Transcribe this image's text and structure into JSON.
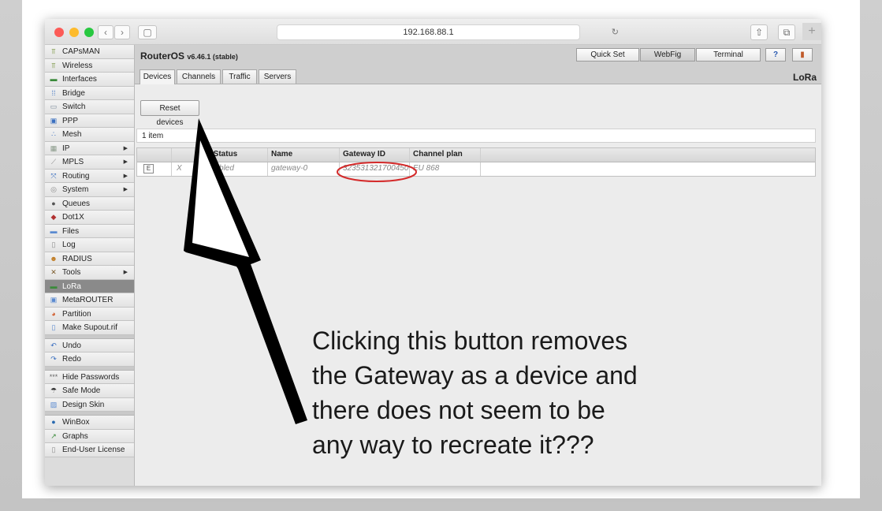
{
  "browser": {
    "address": "192.168.88.1"
  },
  "sidebar": {
    "items": [
      {
        "label": "CAPsMAN",
        "icon": "antenna-icon",
        "glyph": "⫪",
        "color": "#6a8a2a"
      },
      {
        "label": "Wireless",
        "icon": "antenna-icon",
        "glyph": "⫪",
        "color": "#6a8a2a"
      },
      {
        "label": "Interfaces",
        "icon": "interfaces-icon",
        "glyph": "▬",
        "color": "#3a8a3a"
      },
      {
        "label": "Bridge",
        "icon": "bridge-icon",
        "glyph": "⁞⁞",
        "color": "#3a6fc0"
      },
      {
        "label": "Switch",
        "icon": "switch-icon",
        "glyph": "▭",
        "color": "#7a8a9a"
      },
      {
        "label": "PPP",
        "icon": "ppp-icon",
        "glyph": "▣",
        "color": "#3a6fc0"
      },
      {
        "label": "Mesh",
        "icon": "mesh-icon",
        "glyph": "∴",
        "color": "#3a6fc0"
      },
      {
        "label": "IP",
        "icon": "ip-icon",
        "glyph": "▦",
        "color": "#8a9a8a",
        "submenu": true
      },
      {
        "label": "MPLS",
        "icon": "mpls-icon",
        "glyph": "⟋",
        "color": "#8a8a8a",
        "submenu": true
      },
      {
        "label": "Routing",
        "icon": "routing-icon",
        "glyph": "⤧",
        "color": "#3a6fc0",
        "submenu": true
      },
      {
        "label": "System",
        "icon": "system-icon",
        "glyph": "◎",
        "color": "#8a8a8a",
        "submenu": true
      },
      {
        "label": "Queues",
        "icon": "queues-icon",
        "glyph": "●",
        "color": "#555555"
      },
      {
        "label": "Dot1X",
        "icon": "dot1x-icon",
        "glyph": "◆",
        "color": "#b03030"
      },
      {
        "label": "Files",
        "icon": "files-icon",
        "glyph": "▬",
        "color": "#5a8ad0"
      },
      {
        "label": "Log",
        "icon": "log-icon",
        "glyph": "▯",
        "color": "#8a8a8a"
      },
      {
        "label": "RADIUS",
        "icon": "radius-icon",
        "glyph": "☻",
        "color": "#c07a20"
      },
      {
        "label": "Tools",
        "icon": "tools-icon",
        "glyph": "✕",
        "color": "#7a5a2a",
        "submenu": true
      },
      {
        "label": "LoRa",
        "icon": "lora-icon",
        "glyph": "▬",
        "color": "#3a8a3a",
        "active": true
      },
      {
        "label": "MetaROUTER",
        "icon": "metarouter-icon",
        "glyph": "▣",
        "color": "#5a8ad0"
      },
      {
        "label": "Partition",
        "icon": "partition-icon",
        "glyph": "◕",
        "color": "#d05a2a"
      },
      {
        "label": "Make Supout.rif",
        "icon": "supout-icon",
        "glyph": "▯",
        "color": "#5a8ad0"
      },
      {
        "gap": true
      },
      {
        "label": "Undo",
        "icon": "undo-icon",
        "glyph": "↶",
        "color": "#3a6fc0"
      },
      {
        "label": "Redo",
        "icon": "redo-icon",
        "glyph": "↷",
        "color": "#3a6fc0"
      },
      {
        "gap": true
      },
      {
        "label": "Hide Passwords",
        "icon": "hide-passwords-icon",
        "glyph": "***",
        "color": "#666666"
      },
      {
        "label": "Safe Mode",
        "icon": "safe-mode-icon",
        "glyph": "☂",
        "color": "#333333"
      },
      {
        "label": "Design Skin",
        "icon": "design-skin-icon",
        "glyph": "▨",
        "color": "#5a8ad0"
      },
      {
        "gap": true
      },
      {
        "label": "WinBox",
        "icon": "winbox-icon",
        "glyph": "●",
        "color": "#2a6ab0"
      },
      {
        "label": "Graphs",
        "icon": "graphs-icon",
        "glyph": "↗",
        "color": "#3a8a3a"
      },
      {
        "label": "End-User License",
        "icon": "license-icon",
        "glyph": "▯",
        "color": "#8a8a8a"
      }
    ]
  },
  "header": {
    "product": "RouterOS",
    "version": "v6.46.1 (stable)",
    "quick_set": "Quick Set",
    "webfig": "WebFig",
    "terminal": "Terminal"
  },
  "tabs": [
    {
      "label": "Devices",
      "selected": true
    },
    {
      "label": "Channels"
    },
    {
      "label": "Traffic"
    },
    {
      "label": "Servers"
    }
  ],
  "panel_title": "LoRa",
  "reset_button": "Reset devices",
  "item_count": "1 item",
  "table": {
    "columns": {
      "status": "▲ Status",
      "name": "Name",
      "gateway_id": "Gateway ID",
      "channel_plan": "Channel plan"
    },
    "rows": [
      {
        "edit": "E",
        "flag": "X",
        "status": "Disabled",
        "name": "gateway-0",
        "gateway_id": "323531321700450",
        "channel_plan": "EU 868"
      }
    ]
  },
  "annotation": {
    "lines": [
      "Clicking this button removes",
      "the Gateway as a device and",
      "there does not seem to be",
      "any way to recreate it???"
    ],
    "highlight_color": "#d42a2a"
  }
}
